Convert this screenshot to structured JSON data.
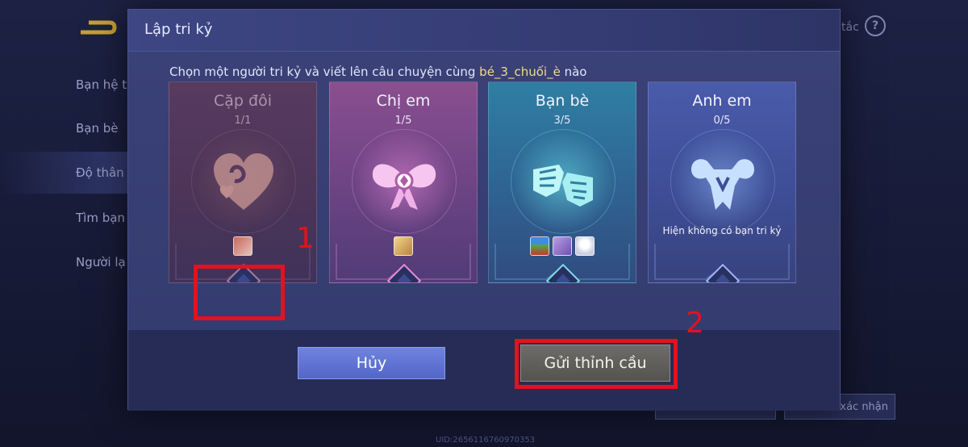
{
  "background": {
    "help_text": "tắc",
    "help_icon_glyph": "?",
    "nav_items": [
      "Bạn hệ t",
      "Bạn bè",
      "Độ thân",
      "Tìm bạn",
      "Người lạ"
    ],
    "bottom_text": "",
    "bottom_buttons": [
      "",
      "xác nhận"
    ],
    "uid": "UID:2656116760970353"
  },
  "dialog": {
    "title": "Lập tri kỷ",
    "subtitle_prefix": "Chọn một người tri kỷ và viết lên câu chuyện cùng ",
    "subtitle_name": "bé_3_chuối_è",
    "subtitle_suffix": " nào",
    "cards": [
      {
        "title": "Cặp đôi",
        "count": "1/1",
        "icon": "heart-icon",
        "note": ""
      },
      {
        "title": "Chị em",
        "count": "1/5",
        "icon": "bow-icon",
        "note": ""
      },
      {
        "title": "Bạn bè",
        "count": "3/5",
        "icon": "fist-bump-icon",
        "note": ""
      },
      {
        "title": "Anh em",
        "count": "0/5",
        "icon": "muscle-icon",
        "note": "Hiện không có bạn tri kỷ"
      }
    ],
    "cancel_label": "Hủy",
    "send_label": "Gửi thỉnh cầu"
  },
  "annotations": {
    "marker_1": "1",
    "marker_2": "2",
    "color": "#e3121c"
  },
  "colors": {
    "accent_name": "#f1d995",
    "cancel_button": "#5d70d2",
    "send_button": "#605e5a"
  }
}
